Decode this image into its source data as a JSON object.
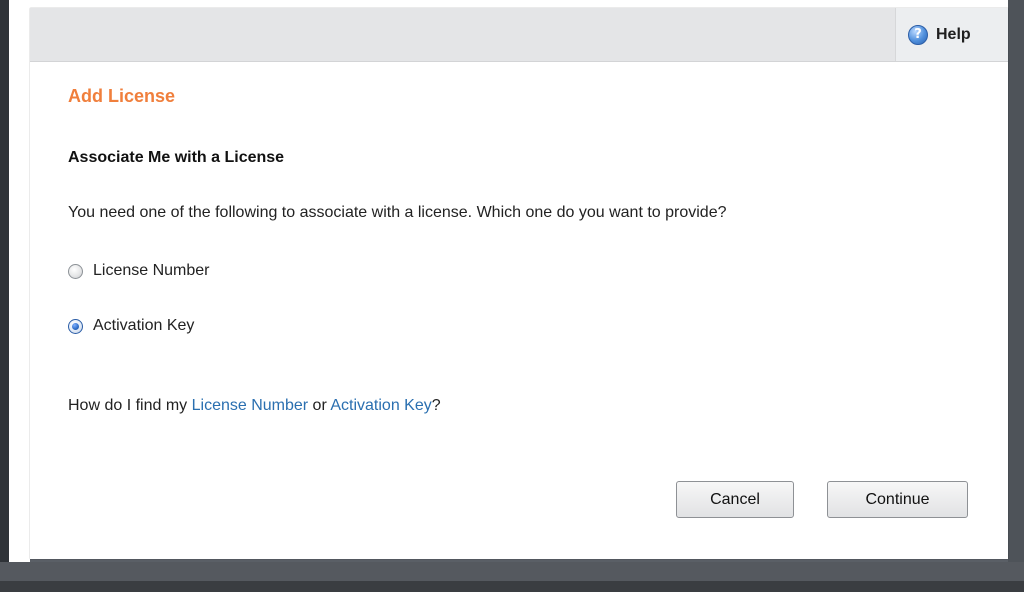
{
  "help": {
    "label": "Help",
    "icon": "help-circle-icon",
    "icon_glyph": "?"
  },
  "dialog": {
    "title": "Add License",
    "subtitle": "Associate Me with a License",
    "question": "You need one of the following to associate with a license. Which one do you want to provide?"
  },
  "options": [
    {
      "label": "License Number",
      "selected": false
    },
    {
      "label": "Activation Key",
      "selected": true
    }
  ],
  "help_line": {
    "prefix": "How do I find my ",
    "link1": "License Number",
    "middle": " or ",
    "link2": "Activation Key",
    "suffix": "?"
  },
  "buttons": {
    "cancel": "Cancel",
    "continue": "Continue"
  },
  "colors": {
    "title": "#f07f3c",
    "link": "#2a6fb0",
    "titlebar": "#e4e5e7"
  }
}
